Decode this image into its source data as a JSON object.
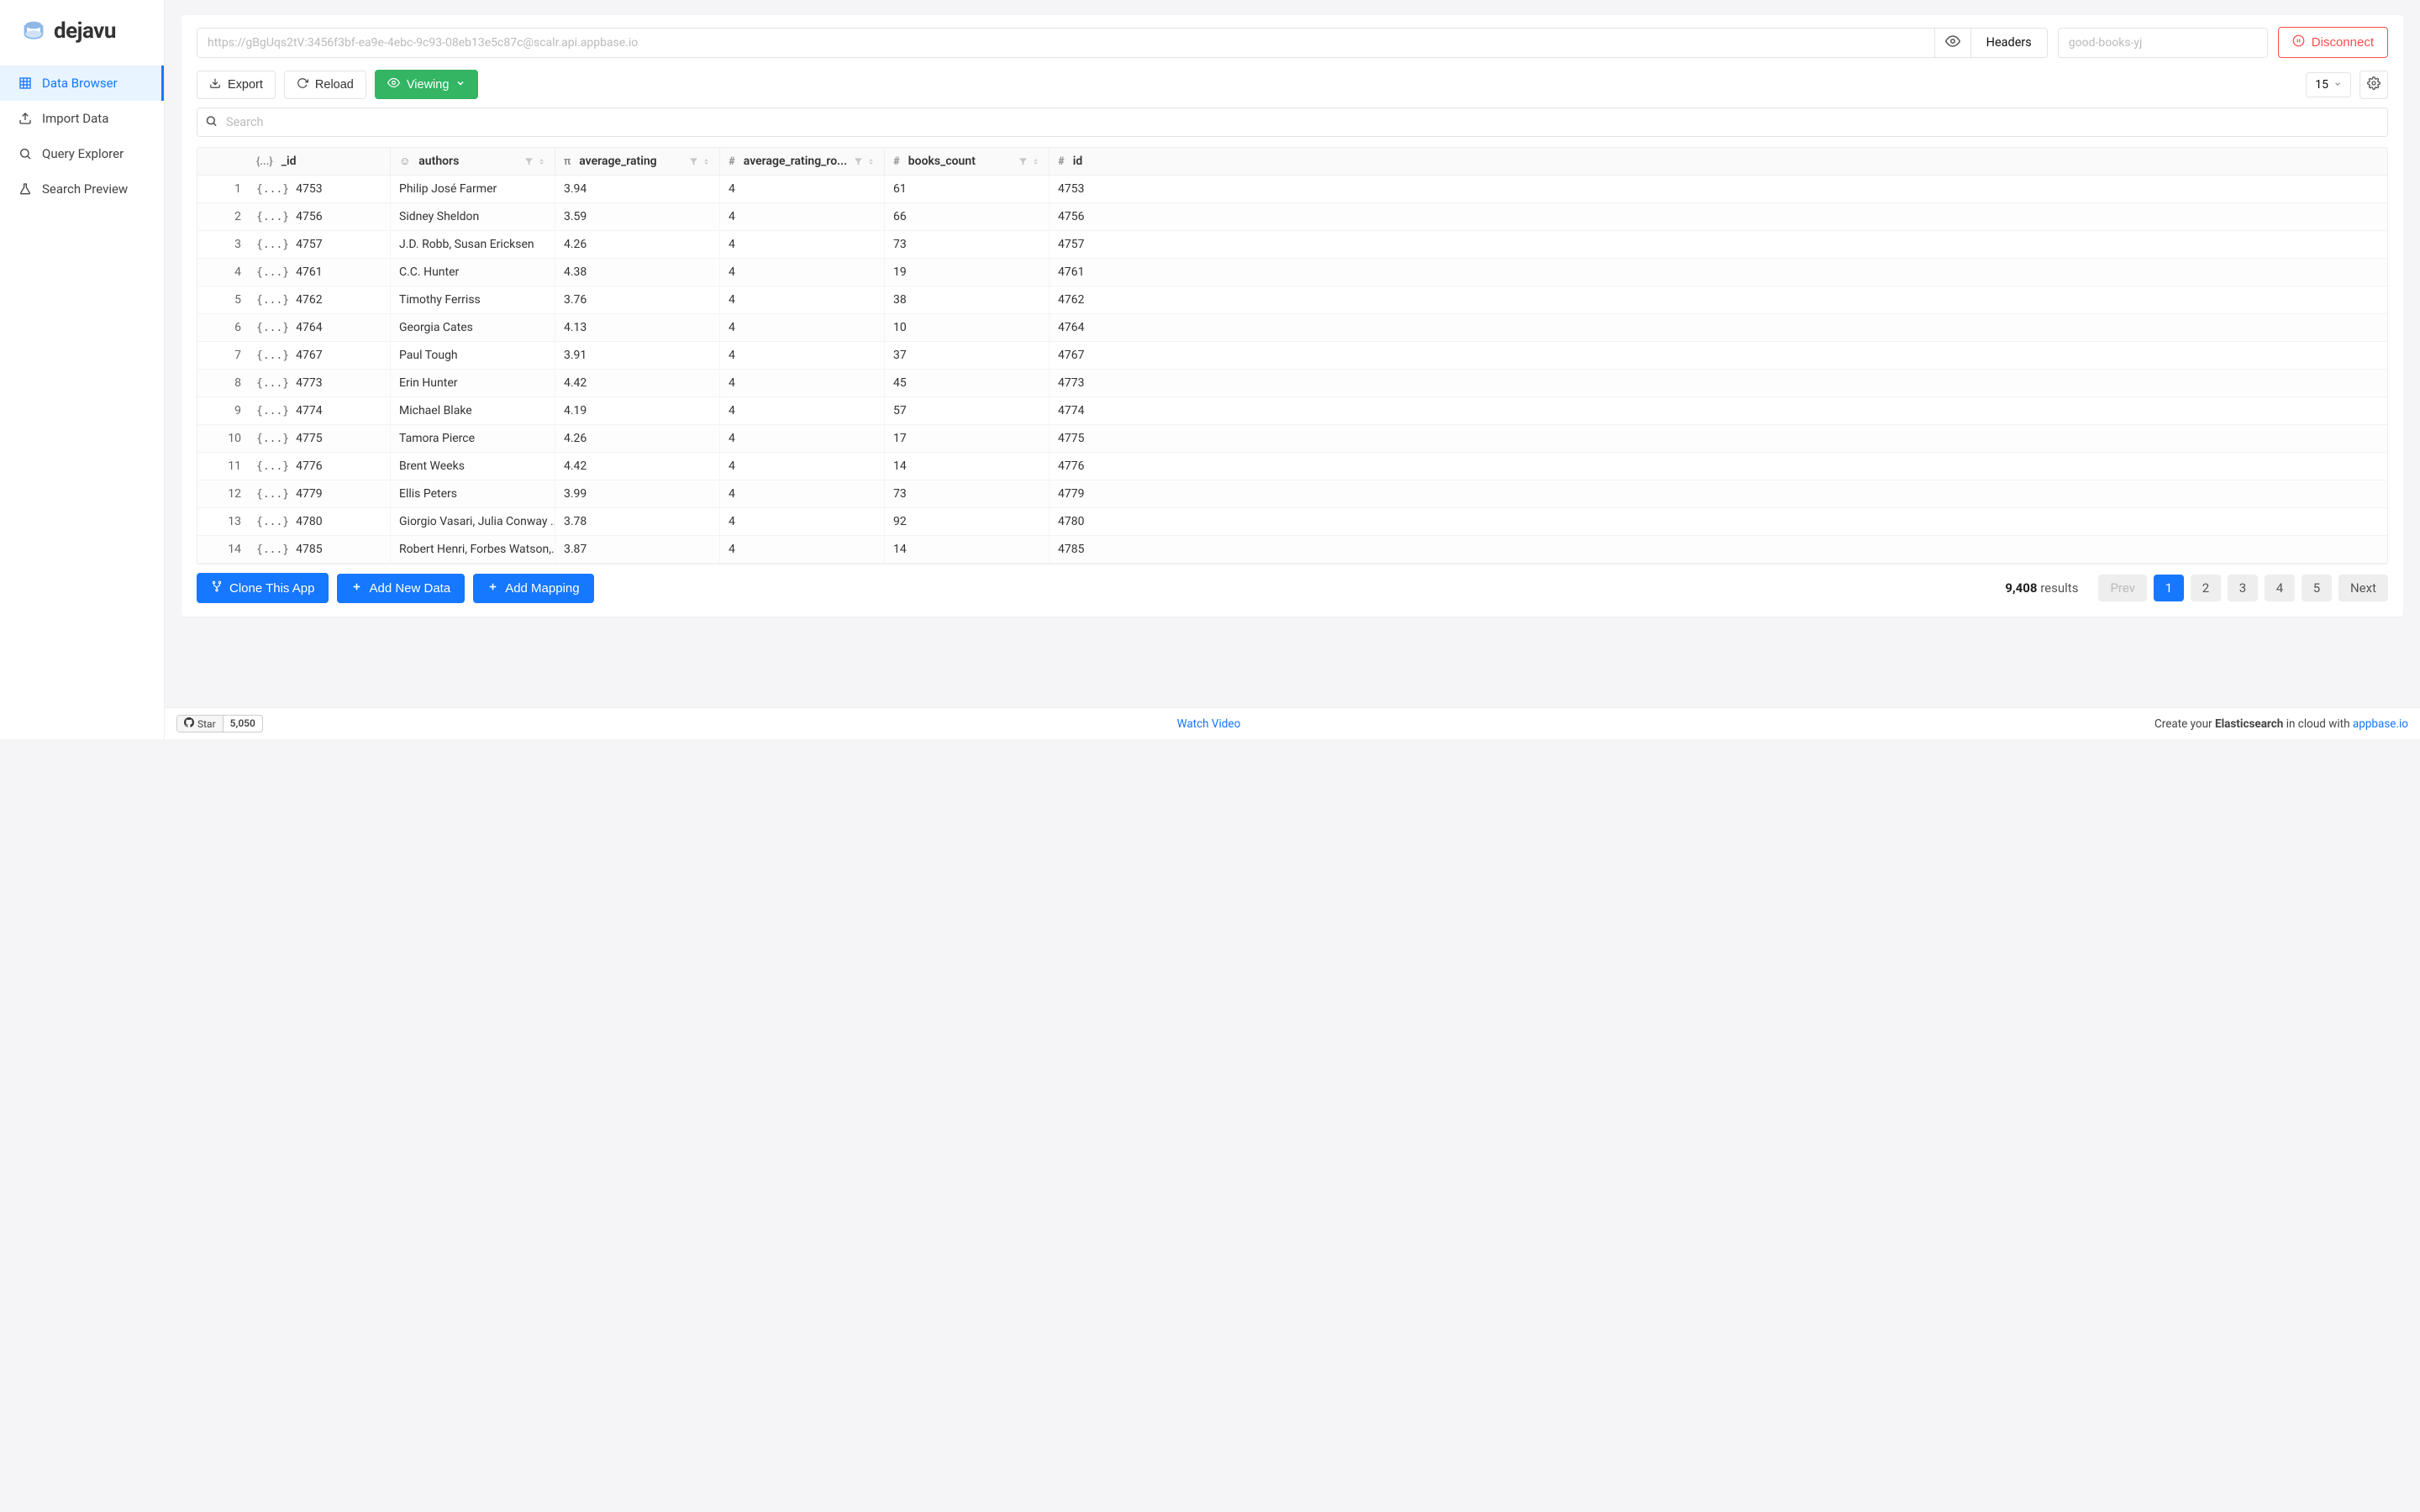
{
  "brand": {
    "name": "dejavu"
  },
  "nav": {
    "items": [
      {
        "label": "Data Browser",
        "icon": "grid-icon",
        "active": true
      },
      {
        "label": "Import Data",
        "icon": "upload-icon",
        "active": false
      },
      {
        "label": "Query Explorer",
        "icon": "search-icon",
        "active": false
      },
      {
        "label": "Search Preview",
        "icon": "flask-icon",
        "active": false
      }
    ]
  },
  "header": {
    "url_placeholder": "https://gBgUqs2tV:3456f3bf-ea9e-4ebc-9c93-08eb13e5c87c@scalr.api.appbase.io",
    "headers_label": "Headers",
    "index_placeholder": "good-books-yj",
    "disconnect_label": "Disconnect"
  },
  "actions": {
    "export_label": "Export",
    "reload_label": "Reload",
    "viewing_label": "Viewing",
    "page_size": "15"
  },
  "search": {
    "placeholder": "Search"
  },
  "table": {
    "columns": [
      {
        "key": "_id",
        "label": "_id",
        "type": "json"
      },
      {
        "key": "authors",
        "label": "authors",
        "type": "text"
      },
      {
        "key": "average_rating",
        "label": "average_rating",
        "type": "float"
      },
      {
        "key": "average_rating_rounded",
        "label": "average_rating_ro...",
        "type": "number"
      },
      {
        "key": "books_count",
        "label": "books_count",
        "type": "number"
      },
      {
        "key": "id",
        "label": "id",
        "type": "number"
      }
    ],
    "rows": [
      {
        "n": "1",
        "_id": "4753",
        "authors": "Philip José Farmer",
        "average_rating": "3.94",
        "average_rating_rounded": "4",
        "books_count": "61",
        "id": "4753"
      },
      {
        "n": "2",
        "_id": "4756",
        "authors": "Sidney Sheldon",
        "average_rating": "3.59",
        "average_rating_rounded": "4",
        "books_count": "66",
        "id": "4756"
      },
      {
        "n": "3",
        "_id": "4757",
        "authors": "J.D. Robb, Susan Ericksen",
        "average_rating": "4.26",
        "average_rating_rounded": "4",
        "books_count": "73",
        "id": "4757"
      },
      {
        "n": "4",
        "_id": "4761",
        "authors": "C.C. Hunter",
        "average_rating": "4.38",
        "average_rating_rounded": "4",
        "books_count": "19",
        "id": "4761"
      },
      {
        "n": "5",
        "_id": "4762",
        "authors": "Timothy Ferriss",
        "average_rating": "3.76",
        "average_rating_rounded": "4",
        "books_count": "38",
        "id": "4762"
      },
      {
        "n": "6",
        "_id": "4764",
        "authors": "Georgia Cates",
        "average_rating": "4.13",
        "average_rating_rounded": "4",
        "books_count": "10",
        "id": "4764"
      },
      {
        "n": "7",
        "_id": "4767",
        "authors": "Paul Tough",
        "average_rating": "3.91",
        "average_rating_rounded": "4",
        "books_count": "37",
        "id": "4767"
      },
      {
        "n": "8",
        "_id": "4773",
        "authors": "Erin Hunter",
        "average_rating": "4.42",
        "average_rating_rounded": "4",
        "books_count": "45",
        "id": "4773"
      },
      {
        "n": "9",
        "_id": "4774",
        "authors": "Michael Blake",
        "average_rating": "4.19",
        "average_rating_rounded": "4",
        "books_count": "57",
        "id": "4774"
      },
      {
        "n": "10",
        "_id": "4775",
        "authors": "Tamora Pierce",
        "average_rating": "4.26",
        "average_rating_rounded": "4",
        "books_count": "17",
        "id": "4775"
      },
      {
        "n": "11",
        "_id": "4776",
        "authors": "Brent Weeks",
        "average_rating": "4.42",
        "average_rating_rounded": "4",
        "books_count": "14",
        "id": "4776"
      },
      {
        "n": "12",
        "_id": "4779",
        "authors": "Ellis Peters",
        "average_rating": "3.99",
        "average_rating_rounded": "4",
        "books_count": "73",
        "id": "4779"
      },
      {
        "n": "13",
        "_id": "4780",
        "authors": "Giorgio Vasari, Julia Conway ...",
        "average_rating": "3.78",
        "average_rating_rounded": "4",
        "books_count": "92",
        "id": "4780"
      },
      {
        "n": "14",
        "_id": "4785",
        "authors": "Robert Henri, Forbes Watson,...",
        "average_rating": "3.87",
        "average_rating_rounded": "4",
        "books_count": "14",
        "id": "4785"
      }
    ]
  },
  "bottom": {
    "clone_label": "Clone This App",
    "add_data_label": "Add New Data",
    "add_mapping_label": "Add Mapping",
    "results_count": "9,408",
    "results_suffix": "results",
    "pages": [
      "1",
      "2",
      "3",
      "4",
      "5"
    ],
    "prev_label": "Prev",
    "next_label": "Next"
  },
  "footer": {
    "star_label": "Star",
    "star_count": "5,050",
    "watch_video": "Watch Video",
    "promo_prefix": "Create your ",
    "promo_bold": "Elasticsearch",
    "promo_mid": " in cloud with ",
    "promo_link": "appbase.io"
  }
}
